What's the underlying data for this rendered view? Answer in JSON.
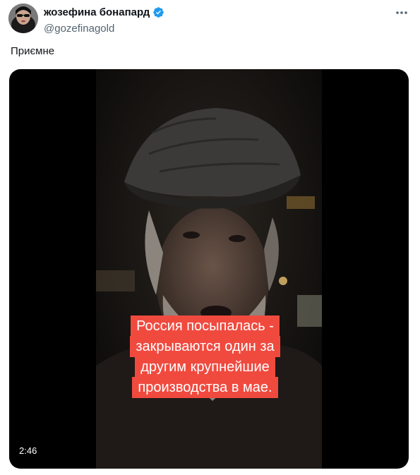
{
  "author": {
    "display_name": "жозефина бонапард",
    "handle": "@gozefinagold",
    "verified_icon": "verified-badge-icon",
    "avatar_icon": "avatar"
  },
  "tweet": {
    "text": "Приємне",
    "more_icon": "more-horizontal-icon"
  },
  "video": {
    "duration": "2:46",
    "caption_lines": [
      "Россия посыпалась -",
      "закрываются один за",
      "другим крупнейшие",
      "производства в мае."
    ],
    "caption_bg": "#f04a3f"
  },
  "colors": {
    "text_primary": "#0f1419",
    "text_secondary": "#536471",
    "verified_blue": "#1d9bf0"
  }
}
